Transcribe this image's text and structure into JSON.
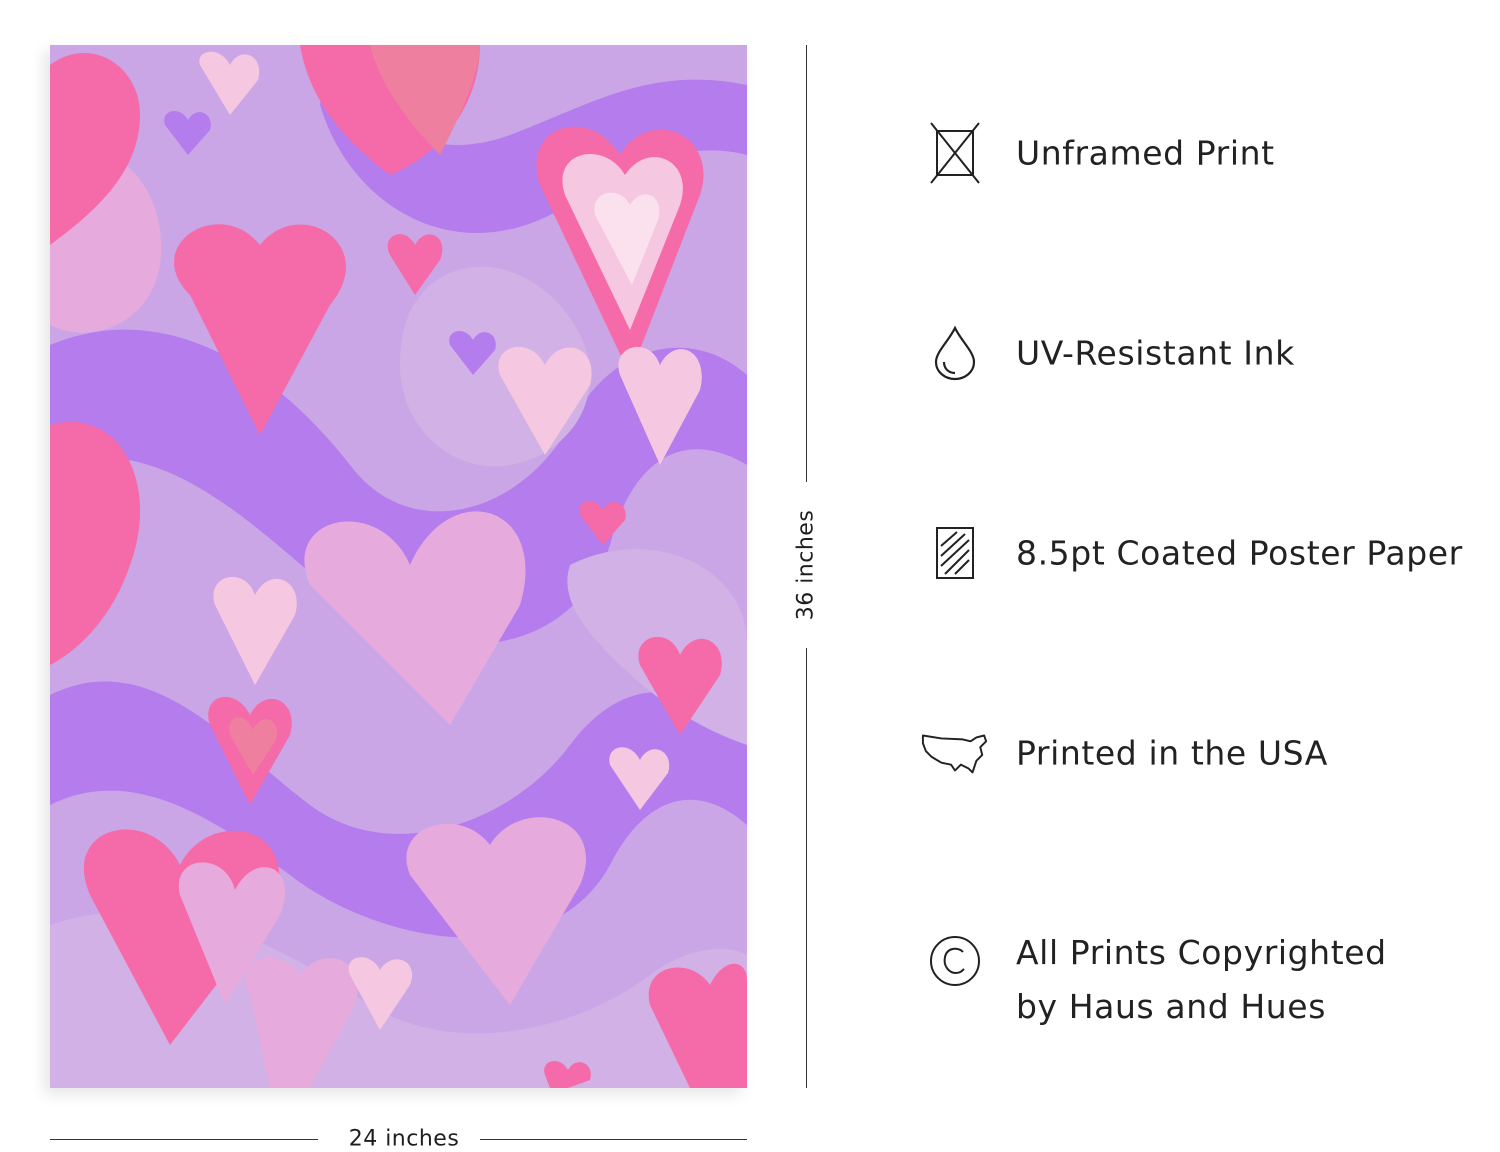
{
  "poster": {
    "palette": {
      "base": "#cba6e6",
      "violet": "#b47ced",
      "lavender": "#d2b1e6",
      "lilac": "#e7aadc",
      "pink": "#f56aa8",
      "blush": "#f6c7e0",
      "coral": "#ef7f9f"
    }
  },
  "dimensions": {
    "height_label": "36 inches",
    "width_label": "24 inches"
  },
  "features": [
    {
      "icon": "unframed-icon",
      "label": "Unframed Print"
    },
    {
      "icon": "ink-drop-icon",
      "label": "UV-Resistant Ink"
    },
    {
      "icon": "paper-icon",
      "label": "8.5pt Coated Poster Paper"
    },
    {
      "icon": "usa-map-icon",
      "label": "Printed in the USA"
    },
    {
      "icon": "copyright-icon",
      "label_line1": "All Prints Copyrighted",
      "label_line2": "by Haus and Hues"
    }
  ]
}
